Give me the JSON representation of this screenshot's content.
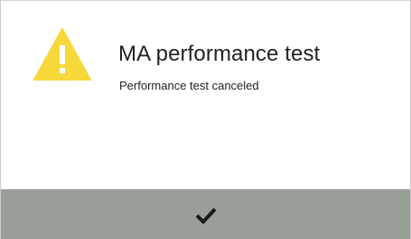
{
  "dialog": {
    "title": "MA performance test",
    "message": "Performance test canceled",
    "icon": "warning-icon",
    "confirm_icon": "checkmark-icon"
  },
  "colors": {
    "warning": "#f6d83a",
    "footer": "#989f97",
    "text": "#222222",
    "checkmark": "#1a1a1a"
  }
}
